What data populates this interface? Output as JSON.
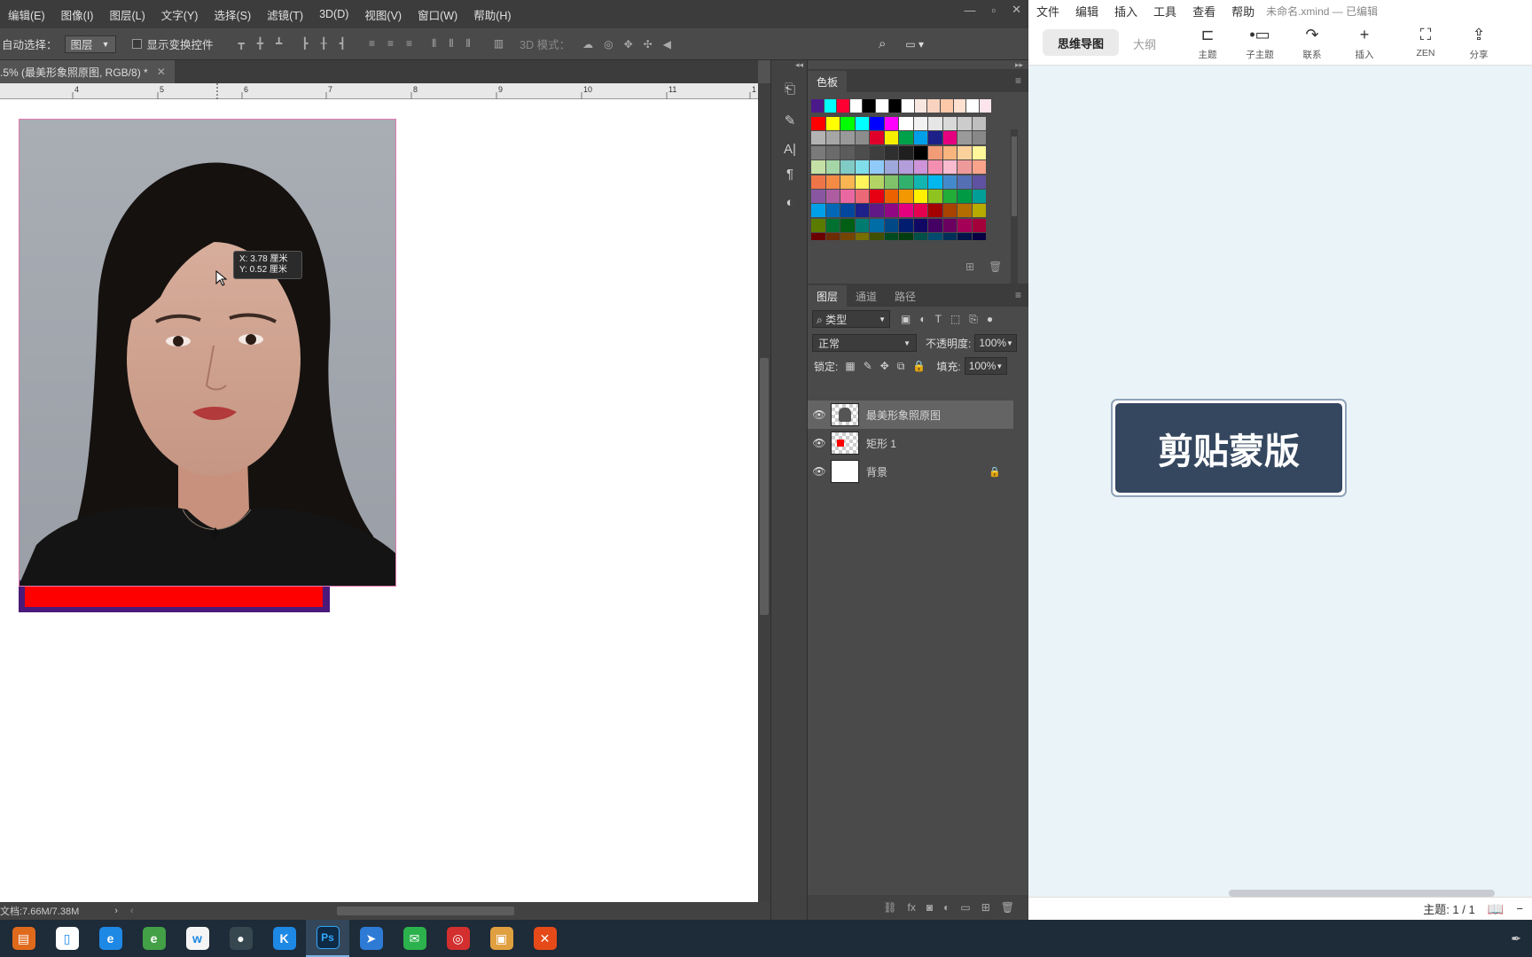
{
  "photoshop": {
    "menu": [
      "编辑(E)",
      "图像(I)",
      "图层(L)",
      "文字(Y)",
      "选择(S)",
      "滤镜(T)",
      "3D(D)",
      "视图(V)",
      "窗口(W)",
      "帮助(H)"
    ],
    "options": {
      "auto_select_label": "自动选择：",
      "auto_select_value": "图层",
      "show_transform_label": "显示变换控件",
      "mode_3d_label": "3D 模式："
    },
    "document_tab": ".5% (最美形象照原图, RGB/8) *",
    "ruler_ticks": [
      "4",
      "5",
      "6",
      "7",
      "8",
      "9",
      "10",
      "11",
      "1"
    ],
    "tooltip": {
      "line1": "X: 3.78 厘米",
      "line2": "Y: 0.52 厘米"
    },
    "status": "文档:7.66M/7.38M",
    "swatches_panel": {
      "title": "色板"
    },
    "layers_panel": {
      "tabs": [
        "图层",
        "通道",
        "路径"
      ],
      "filter_kind": "类型",
      "blend_mode": "正常",
      "opacity_label": "不透明度:",
      "opacity_value": "100%",
      "lock_label": "锁定:",
      "fill_label": "填充:",
      "fill_value": "100%",
      "layers": [
        {
          "name": "最美形象照原图",
          "selected": true
        },
        {
          "name": "矩形 1",
          "selected": false
        },
        {
          "name": "背景",
          "selected": false,
          "locked": true
        }
      ]
    }
  },
  "xmind": {
    "menu": [
      "文件",
      "编辑",
      "插入",
      "工具",
      "查看",
      "帮助"
    ],
    "title": "未命名.xmind — 已编辑",
    "tabs": {
      "mindmap": "思维导图",
      "outline": "大纲"
    },
    "toolbar": [
      {
        "icon": "topic-icon",
        "label": "主题"
      },
      {
        "icon": "subtopic-icon",
        "label": "子主题"
      },
      {
        "icon": "relationship-icon",
        "label": "联系"
      },
      {
        "icon": "insert-icon",
        "label": "插入"
      },
      {
        "icon": "zen-icon",
        "label": "ZEN"
      },
      {
        "icon": "share-icon",
        "label": "分享"
      }
    ],
    "central_topic": "剪贴蒙版",
    "status": {
      "topic_count": "主题: 1 / 1",
      "zoom_minus": "−"
    }
  },
  "colors": {
    "ps_bg": "#535353",
    "ps_menubar": "#3c3c3c",
    "red_rect": "#ff0000",
    "rect_border": "#4a1a7a",
    "xmind_topic": "#35475f",
    "xmind_canvas": "#eaf3f7",
    "taskbar": "#1e2b38"
  },
  "taskbar": {
    "apps": [
      {
        "name": "store-icon",
        "color": "#e06a1c",
        "glyph": "▤"
      },
      {
        "name": "file-icon",
        "color": "#ffffff",
        "glyph": "▯"
      },
      {
        "name": "ie-icon",
        "color": "#1e88e5",
        "glyph": "e"
      },
      {
        "name": "browser-icon",
        "color": "#43a047",
        "glyph": "e"
      },
      {
        "name": "w-icon",
        "color": "#f5f5f5",
        "glyph": "w"
      },
      {
        "name": "media-icon",
        "color": "#37474f",
        "glyph": "●"
      },
      {
        "name": "k-icon",
        "color": "#1e88e5",
        "glyph": "K"
      },
      {
        "name": "photoshop-icon",
        "color": "#0f2a45",
        "glyph": "Ps"
      },
      {
        "name": "feather-icon",
        "color": "#2e7bd6",
        "glyph": "➤"
      },
      {
        "name": "wechat-icon",
        "color": "#2bb24c",
        "glyph": "✉"
      },
      {
        "name": "netease-icon",
        "color": "#d32f2f",
        "glyph": "◎"
      },
      {
        "name": "slides-icon",
        "color": "#e0a040",
        "glyph": "▣"
      },
      {
        "name": "xmind-icon",
        "color": "#e64a19",
        "glyph": "✕"
      }
    ]
  }
}
